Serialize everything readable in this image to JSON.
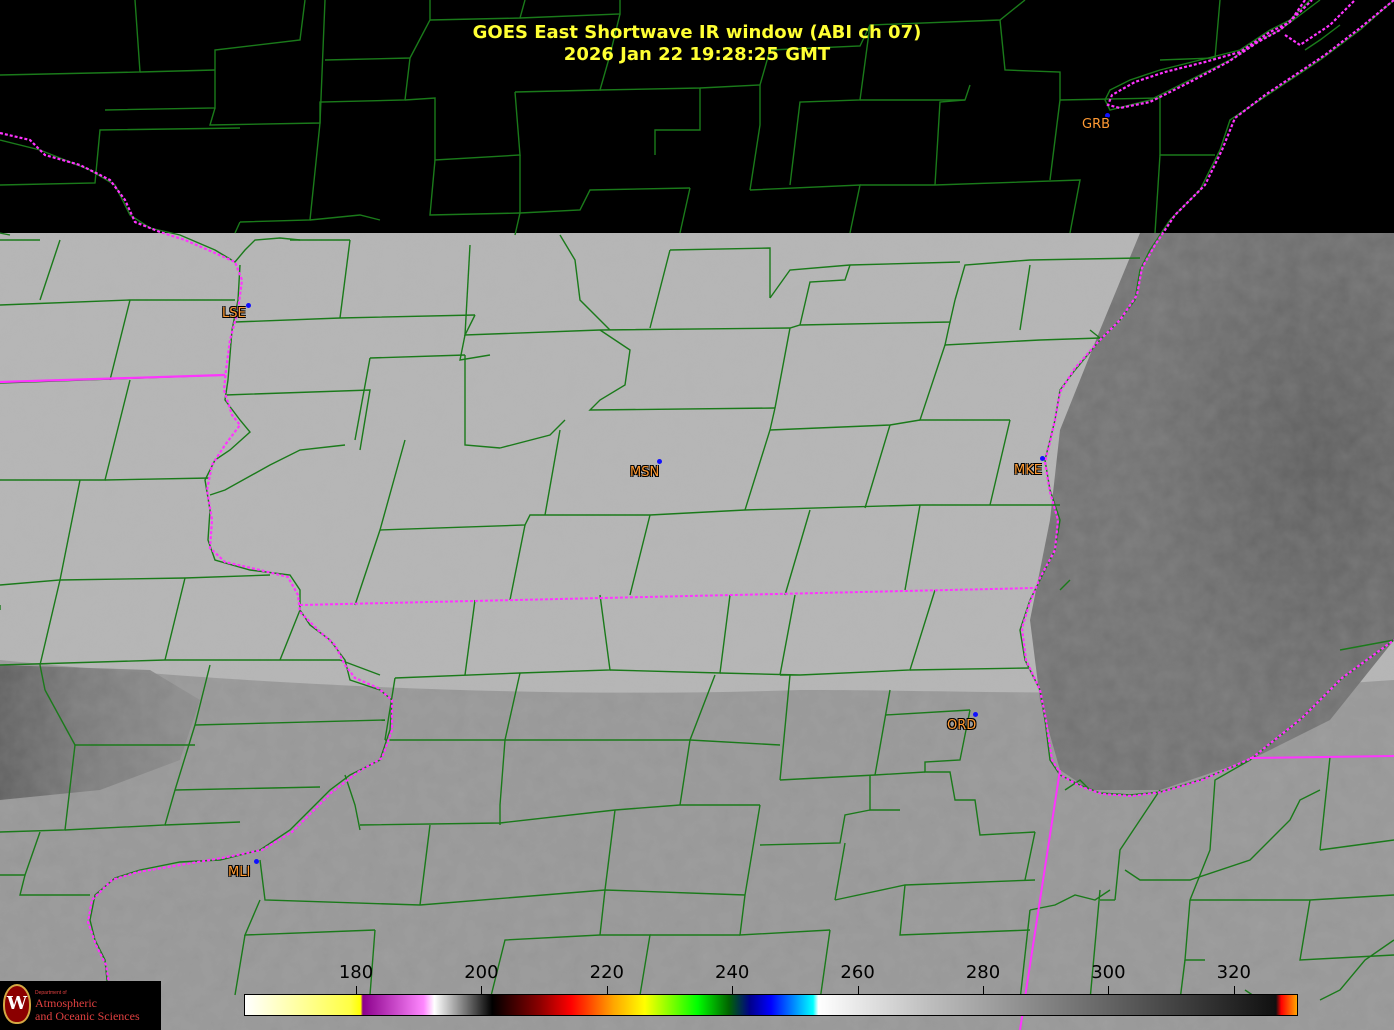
{
  "title": {
    "line1": "GOES East Shortwave IR window (ABI ch 07)",
    "line2": "2026 Jan 22  19:28:25 GMT"
  },
  "stations": [
    {
      "id": "GRB"
    },
    {
      "id": "LSE"
    },
    {
      "id": "MSN"
    },
    {
      "id": "MKE"
    },
    {
      "id": "ORD"
    },
    {
      "id": "MLI"
    }
  ],
  "colorbar": {
    "ticks": [
      "180",
      "200",
      "220",
      "240",
      "260",
      "280",
      "300",
      "320"
    ],
    "stops": [
      {
        "color": "#ffffff",
        "at": 0.0
      },
      {
        "color": "#ffff44",
        "at": 0.1
      },
      {
        "color": "#ffff00",
        "at": 0.11
      },
      {
        "color": "#8b008b",
        "at": 0.112
      },
      {
        "color": "#ff88ff",
        "at": 0.17
      },
      {
        "color": "#ffffff",
        "at": 0.18
      },
      {
        "color": "#000000",
        "at": 0.235
      },
      {
        "color": "#8b0000",
        "at": 0.28
      },
      {
        "color": "#ff0000",
        "at": 0.31
      },
      {
        "color": "#ffa500",
        "at": 0.35
      },
      {
        "color": "#ffff00",
        "at": 0.38
      },
      {
        "color": "#00ff00",
        "at": 0.43
      },
      {
        "color": "#006400",
        "at": 0.46
      },
      {
        "color": "#00008b",
        "at": 0.48
      },
      {
        "color": "#0000ff",
        "at": 0.5
      },
      {
        "color": "#00ffff",
        "at": 0.54
      },
      {
        "color": "#ffffff",
        "at": 0.545
      },
      {
        "color": "#bebebe",
        "at": 0.65
      },
      {
        "color": "#101010",
        "at": 0.98
      },
      {
        "color": "#ff0000",
        "at": 0.985
      },
      {
        "color": "#ffa500",
        "at": 1.0
      }
    ]
  },
  "logo": {
    "department_small": "Department of",
    "line1": "Atmospheric",
    "line2": "and Oceanic Sciences",
    "seal_letter": "W"
  },
  "colors": {
    "title": "#ffff33",
    "county_lines": "#1a7a1a",
    "state_lines": "#ff33ff",
    "station_label": "#ff9a33",
    "station_dot": "#1010ff",
    "cloud_light": "#b8b8b8",
    "cloud_dark": "#5a5a5a"
  }
}
